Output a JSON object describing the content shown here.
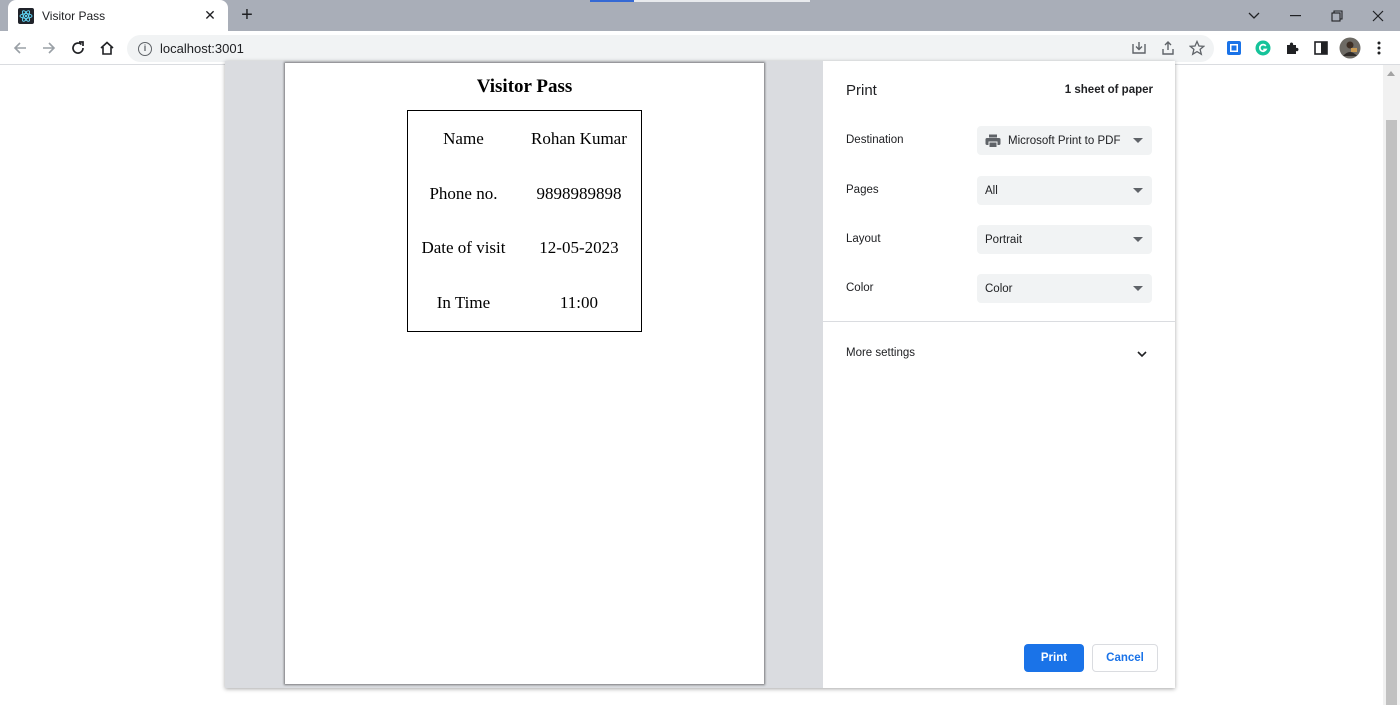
{
  "browser": {
    "tab": {
      "title": "Visitor Pass",
      "close_label": "✕",
      "favicon": "react-icon"
    },
    "new_tab_label": "+",
    "url": "localhost:3001"
  },
  "pass": {
    "title": "Visitor Pass",
    "rows": [
      {
        "label": "Name",
        "value": "Rohan Kumar"
      },
      {
        "label": "Phone no.",
        "value": "9898989898"
      },
      {
        "label": "Date of visit",
        "value": "12-05-2023"
      },
      {
        "label": "In Time",
        "value": "11:00"
      }
    ]
  },
  "print": {
    "header": "Print",
    "sheets": "1 sheet of paper",
    "destination": {
      "label": "Destination",
      "value": "Microsoft Print to PDF"
    },
    "pages": {
      "label": "Pages",
      "value": "All"
    },
    "layout": {
      "label": "Layout",
      "value": "Portrait"
    },
    "color": {
      "label": "Color",
      "value": "Color"
    },
    "more_settings": "More settings",
    "print_button": "Print",
    "cancel_button": "Cancel"
  },
  "colors": {
    "accent": "#1a73e8",
    "tabstrip": "#a9aeb8",
    "preview_bg": "#dadce0"
  }
}
